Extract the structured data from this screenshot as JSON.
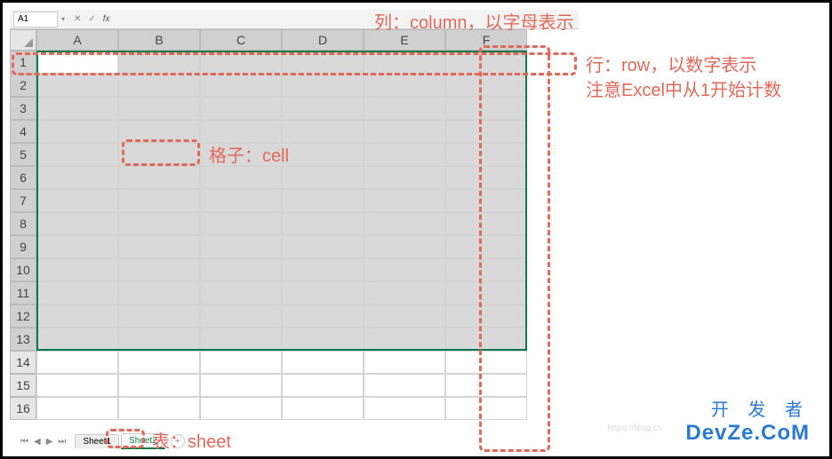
{
  "namebox": {
    "value": "A1"
  },
  "fx_label": "fx",
  "columns": [
    "A",
    "B",
    "C",
    "D",
    "E",
    "F"
  ],
  "rows": [
    "1",
    "2",
    "3",
    "4",
    "5",
    "6",
    "7",
    "8",
    "9",
    "10",
    "11",
    "12",
    "13",
    "14",
    "15",
    "16"
  ],
  "tabs": {
    "items": [
      "Sheet1",
      "Sheet2"
    ],
    "active": 1
  },
  "annotations": {
    "column": "列：column，以字母表示",
    "row_line1": "行：row，以数字表示",
    "row_line2": "注意Excel中从1开始计数",
    "cell": "格子：cell",
    "sheet": "表：sheet"
  },
  "watermark": {
    "cn": "开 发 者",
    "en": "DevZe.CoM",
    "url": "https://blog.cs"
  }
}
